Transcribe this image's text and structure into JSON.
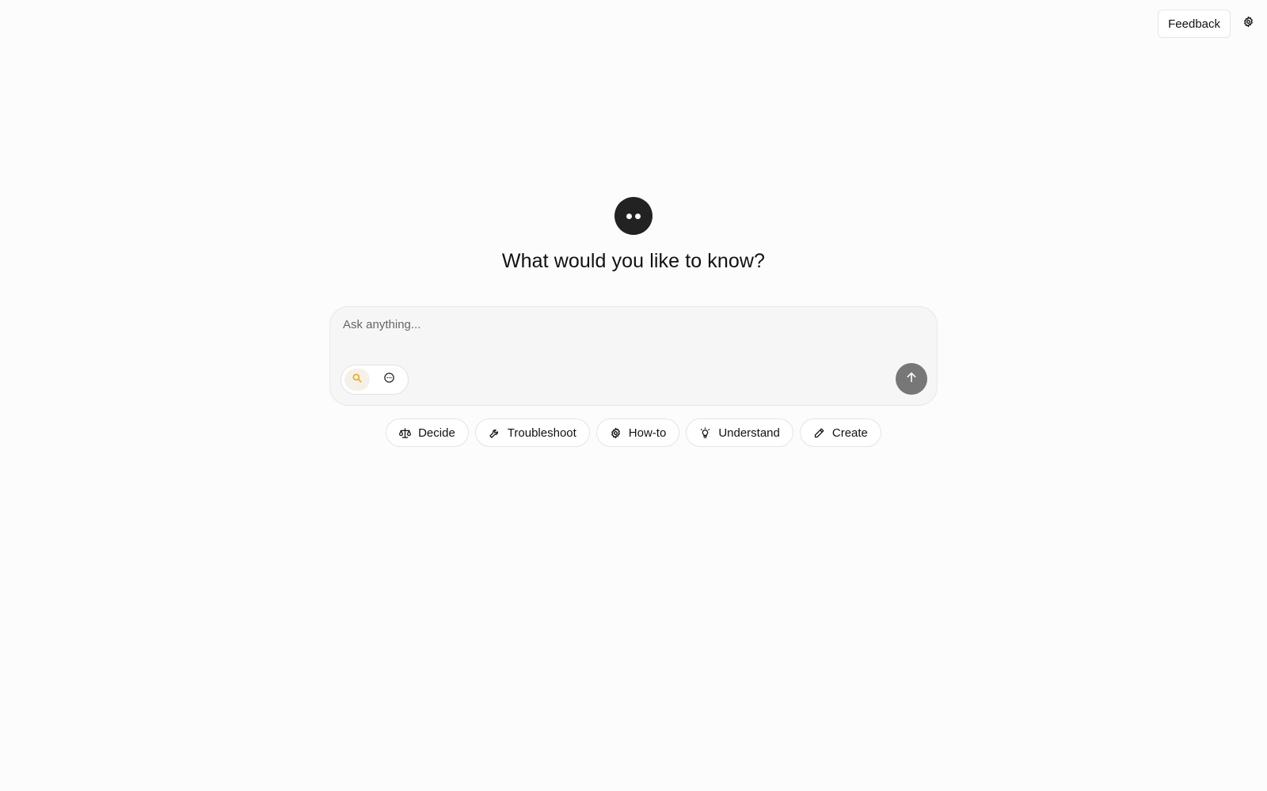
{
  "header": {
    "feedback_label": "Feedback",
    "settings_icon": "gear-icon"
  },
  "hero": {
    "logo_icon": "two-dots-logo",
    "title": "What would you like to know?"
  },
  "composer": {
    "placeholder": "Ask anything...",
    "modes": [
      {
        "icon": "search-icon",
        "active": true
      },
      {
        "icon": "chat-bubble-icon",
        "active": false
      }
    ],
    "send_icon": "arrow-up-icon"
  },
  "suggestions": [
    {
      "label": "Decide",
      "icon": "scale-icon"
    },
    {
      "label": "Troubleshoot",
      "icon": "wrench-icon"
    },
    {
      "label": "How-to",
      "icon": "gear-icon"
    },
    {
      "label": "Understand",
      "icon": "lightbulb-icon"
    },
    {
      "label": "Create",
      "icon": "pencil-icon"
    }
  ],
  "colors": {
    "background": "#fcfcfc",
    "logo": "#222222",
    "send_button": "#777777",
    "search_accent": "#e8a317"
  }
}
